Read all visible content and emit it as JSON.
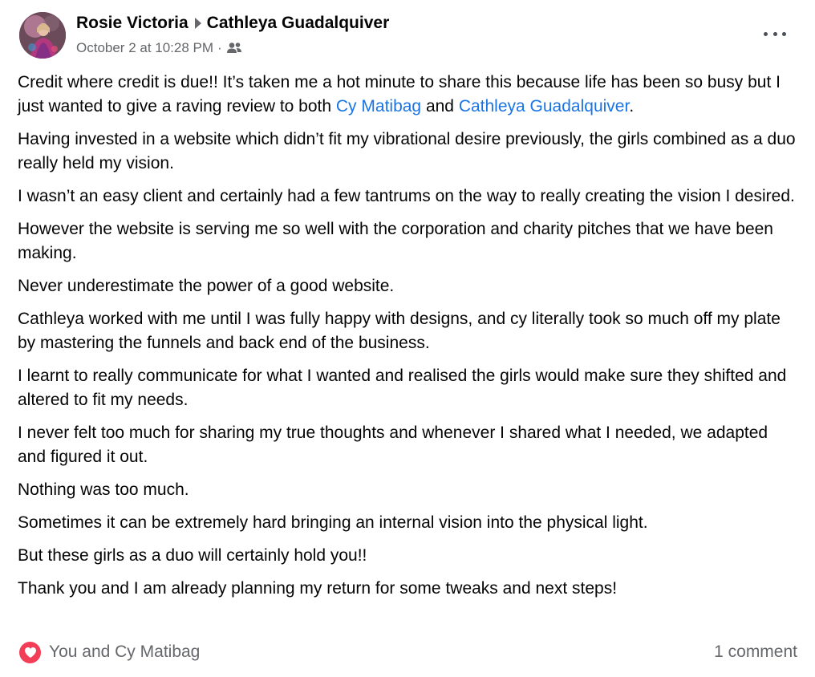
{
  "post": {
    "author": "Rosie Victoria",
    "target": "Cathleya Guadalquiver",
    "timestamp": "October 2 at 10:28 PM",
    "separator": "·",
    "audience_icon": "friends-icon",
    "more_icon": "more-options-icon",
    "body": {
      "p1_a": "Credit where credit is due!! It’s taken me a hot minute to share this because life has been so busy but I just wanted to give a raving review to both ",
      "p1_link1": "Cy Matibag",
      "p1_b": " and ",
      "p1_link2": "Cathleya Guadalquiver",
      "p1_c": ".",
      "paragraphs": [
        "Having invested in a website which didn’t fit my vibrational desire previously, the girls combined as a duo really held my vision.",
        "I wasn’t an easy client and certainly had a few tantrums on the way to really creating the vision I desired.",
        "However the website is serving me so well with the corporation and charity pitches that we have been making.",
        "Never underestimate the power of a good website.",
        "Cathleya worked with me until I was fully happy with designs, and cy literally took so much off my plate by mastering the funnels and back end of the business.",
        "I learnt to really communicate for what I wanted and realised the girls would make sure they shifted and altered to fit my needs.",
        "I never felt too much for sharing my true thoughts and whenever I shared what I needed, we adapted and figured it out.",
        "Nothing was too much.",
        "Sometimes it can be extremely hard bringing an internal vision into the physical light.",
        "But these girls as a duo will certainly hold you!!",
        "Thank you and I am already planning my return for some tweaks and next steps!"
      ]
    },
    "reactions": {
      "icon": "heart-reaction-icon",
      "label": "You and Cy Matibag"
    },
    "comments": "1 comment"
  },
  "colors": {
    "link": "#1b74e4",
    "secondary_text": "#65676b",
    "heart": "#f33e58"
  }
}
